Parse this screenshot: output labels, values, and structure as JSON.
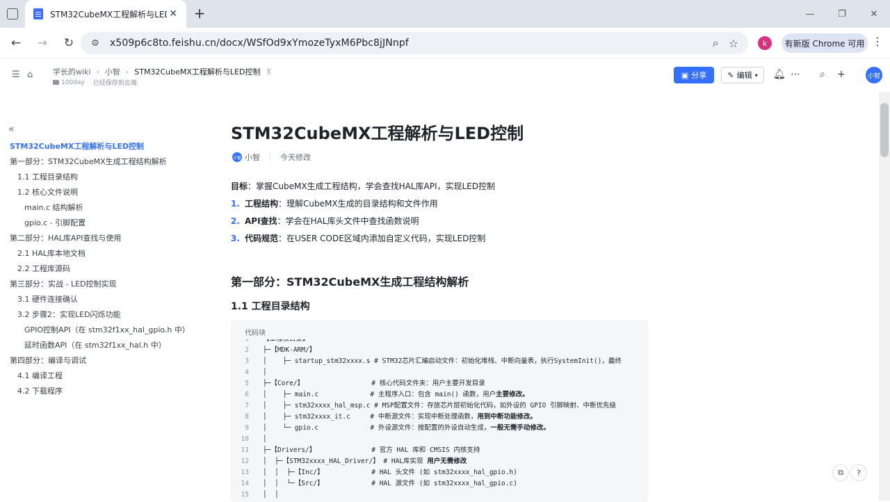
{
  "browser": {
    "tab_title": "STM32CubeMX工程解析与LED控制",
    "url": "x509p6c8to.feishu.cn/docx/WSfOd9xYmozeTyxM6Pbc8jJNnpf",
    "profile_initial": "k",
    "update_label": "有新版 Chrome 可用"
  },
  "header": {
    "breadcrumbs": [
      "学长的wiki",
      "小智",
      "STM32CubeMX工程解析与LED控制"
    ],
    "folder": "100day",
    "save_status": "已经保存到云端",
    "share_label": "分享",
    "edit_label": "编辑",
    "user_avatar": "小智"
  },
  "outline": {
    "items": [
      "STM32CubeMX工程解析与LED控制",
      "第一部分：STM32CubeMX生成工程结构解析",
      "1.1 工程目录结构",
      "1.2 核心文件说明",
      "main.c 结构解析",
      "gpio.c - 引脚配置",
      "第二部分：HAL库API查找与使用",
      "2.1 HAL库本地文档",
      "2.2 工程库源码",
      "第三部分：实战 - LED控制实现",
      "3.1 硬件连接确认",
      "3.2 步骤2：实现LED闪烁功能",
      "GPIO控制API（在 stm32f1xx_hal_gpio.h 中）",
      "延时函数API（在 stm32f1xx_hal.h 中）",
      "第四部分：编译与调试",
      "4.1 编译工程",
      "4.2 下载程序"
    ]
  },
  "doc": {
    "title": "STM32CubeMX工程解析与LED控制",
    "author": "小智",
    "author_avatar": "小智",
    "modified": "今天修改",
    "goal_label": "目标",
    "goal_text": "：掌握CubeMX生成工程结构，学会查找HAL库API，实现LED控制",
    "list": [
      {
        "num": "1.",
        "bold": "工程结构",
        "text": "：理解CubeMX生成的目录结构和文件作用"
      },
      {
        "num": "2.",
        "bold": "API查找",
        "text": "：学会在HAL库头文件中查找函数说明"
      },
      {
        "num": "3.",
        "bold": "代码规范",
        "text": "：在USER CODE区域内添加自定义代码，实现LED控制"
      }
    ],
    "h2": "第一部分：STM32CubeMX生成工程结构解析",
    "h3": "1.1 工程目录结构",
    "code_label": "代码块",
    "code_lines": [
      {
        "n": "1",
        "text": "【工程根目录】",
        "bold": ""
      },
      {
        "n": "2",
        "text": "├─【MDK-ARM/】",
        "bold": ""
      },
      {
        "n": "3",
        "text": "│    ├─ startup_stm32xxxx.s # STM32芯片汇编启动文件：初始化堆栈、中断向量表，执行SystemInit()，最终",
        "bold": ""
      },
      {
        "n": "4",
        "text": "│",
        "bold": ""
      },
      {
        "n": "5",
        "text": "├─【Core/】                 # 核心代码文件夹：用户主要开发目录",
        "bold": ""
      },
      {
        "n": "6",
        "text": "│    ├─ main.c             # 主程序入口：包含 main() 函数，用户",
        "bold": "主要修改。"
      },
      {
        "n": "7",
        "text": "│    ├─ stm32xxxx_hal_msp.c # MSP配置文件：存放芯片层初始化代码，如外设的 GPIO 引脚映射、中断优先级",
        "bold": ""
      },
      {
        "n": "8",
        "text": "│    ├─ stm32xxxx_it.c     # 中断源文件：实现中断处理函数，",
        "bold": "用到中断功能修改。"
      },
      {
        "n": "9",
        "text": "│    └─ gpio.c             # 外设源文件：按配置的外设自动生成，",
        "bold": "一般无需手动修改。"
      },
      {
        "n": "10",
        "text": "│",
        "bold": ""
      },
      {
        "n": "11",
        "text": "├─【Drivers/】              # 官方 HAL 库和 CMSIS 内核支持",
        "bold": ""
      },
      {
        "n": "12",
        "text": "│  ├─【STM32xxxx_HAL_Driver/】 # HAL库实现 ",
        "bold": "用户无需修改"
      },
      {
        "n": "13",
        "text": "│  │  ├─【Inc/】            # HAL 头文件 (如 stm32xxxx_hal_gpio.h)",
        "bold": ""
      },
      {
        "n": "14",
        "text": "│  │  └─【Src/】            # HAL 源文件 (如 stm32xxxx_hal_gpio.c)",
        "bold": ""
      },
      {
        "n": "15",
        "text": "│  │",
        "bold": ""
      }
    ]
  }
}
